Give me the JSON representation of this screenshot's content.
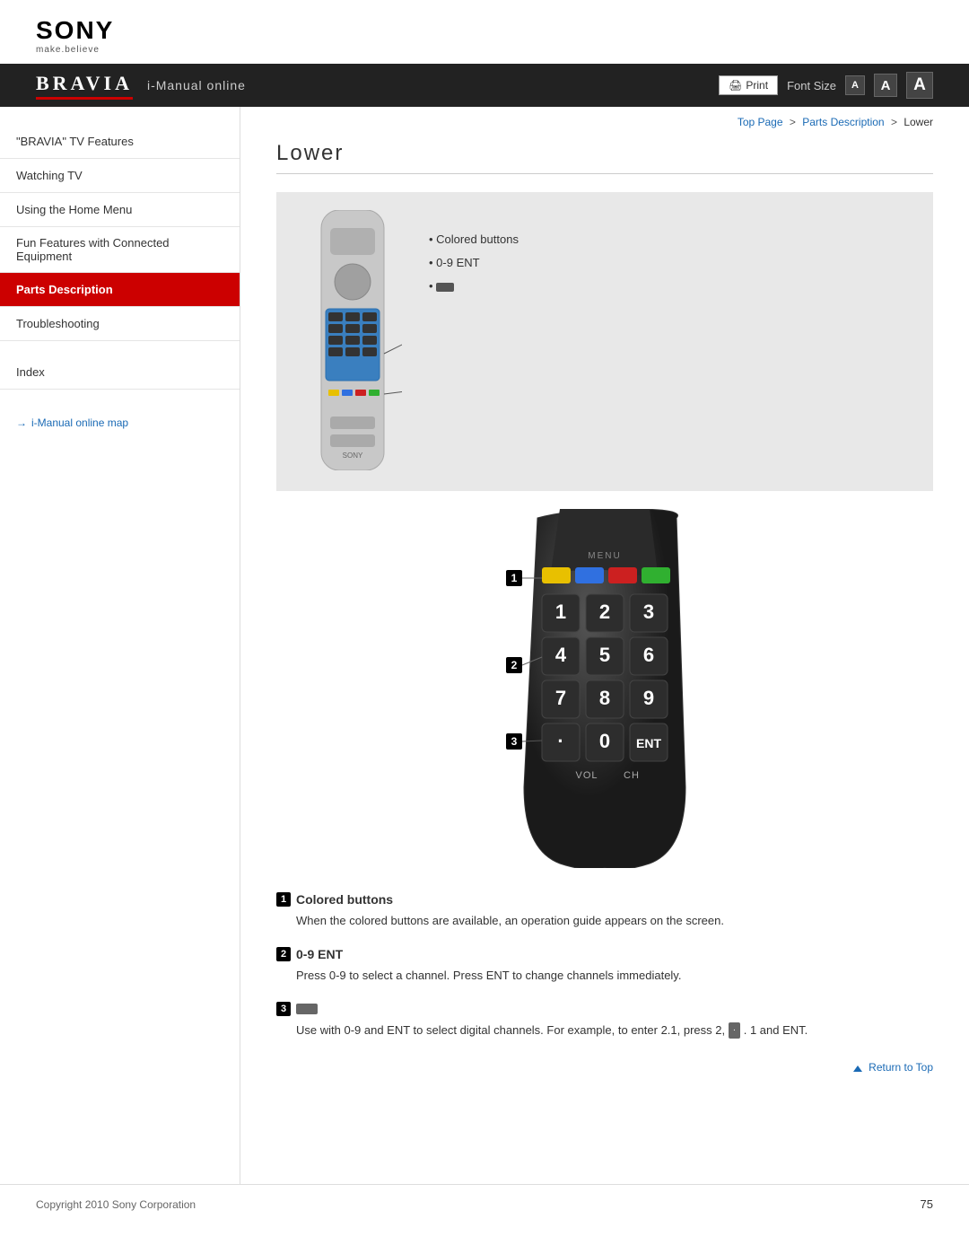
{
  "header": {
    "sony_text": "SONY",
    "tagline": "make.believe",
    "bravia_logo": "BRAVIA",
    "imanual_text": "i-Manual online",
    "print_label": "Print",
    "font_size_label": "Font Size",
    "font_small": "A",
    "font_medium": "A",
    "font_large": "A"
  },
  "breadcrumb": {
    "top_page": "Top Page",
    "parts_description": "Parts Description",
    "current": "Lower",
    "sep": ">"
  },
  "sidebar": {
    "items": [
      {
        "label": "\"BRAVIA\" TV Features",
        "active": false
      },
      {
        "label": "Watching TV",
        "active": false
      },
      {
        "label": "Using the Home Menu",
        "active": false
      },
      {
        "label": "Fun Features with Connected Equipment",
        "active": false
      },
      {
        "label": "Parts Description",
        "active": true
      },
      {
        "label": "Troubleshooting",
        "active": false
      }
    ],
    "index_label": "Index",
    "map_link": "i-Manual online map"
  },
  "page": {
    "title": "Lower",
    "diagram_labels": [
      "Colored buttons",
      "0-9 ENT",
      "·"
    ],
    "section1": {
      "num": "1",
      "title": "Colored buttons",
      "desc": "When the colored buttons are available, an operation guide appears on the screen."
    },
    "section2": {
      "num": "2",
      "title": "0-9 ENT",
      "desc": "Press 0-9 to select a channel. Press ENT to change channels immediately."
    },
    "section3": {
      "num": "3",
      "title": "·",
      "desc": "Use with 0-9 and ENT to select digital channels. For example, to enter 2.1, press 2,",
      "desc2": ". 1 and ENT."
    },
    "return_top": "Return to Top"
  },
  "footer": {
    "copyright": "Copyright 2010 Sony Corporation",
    "page_num": "75"
  }
}
